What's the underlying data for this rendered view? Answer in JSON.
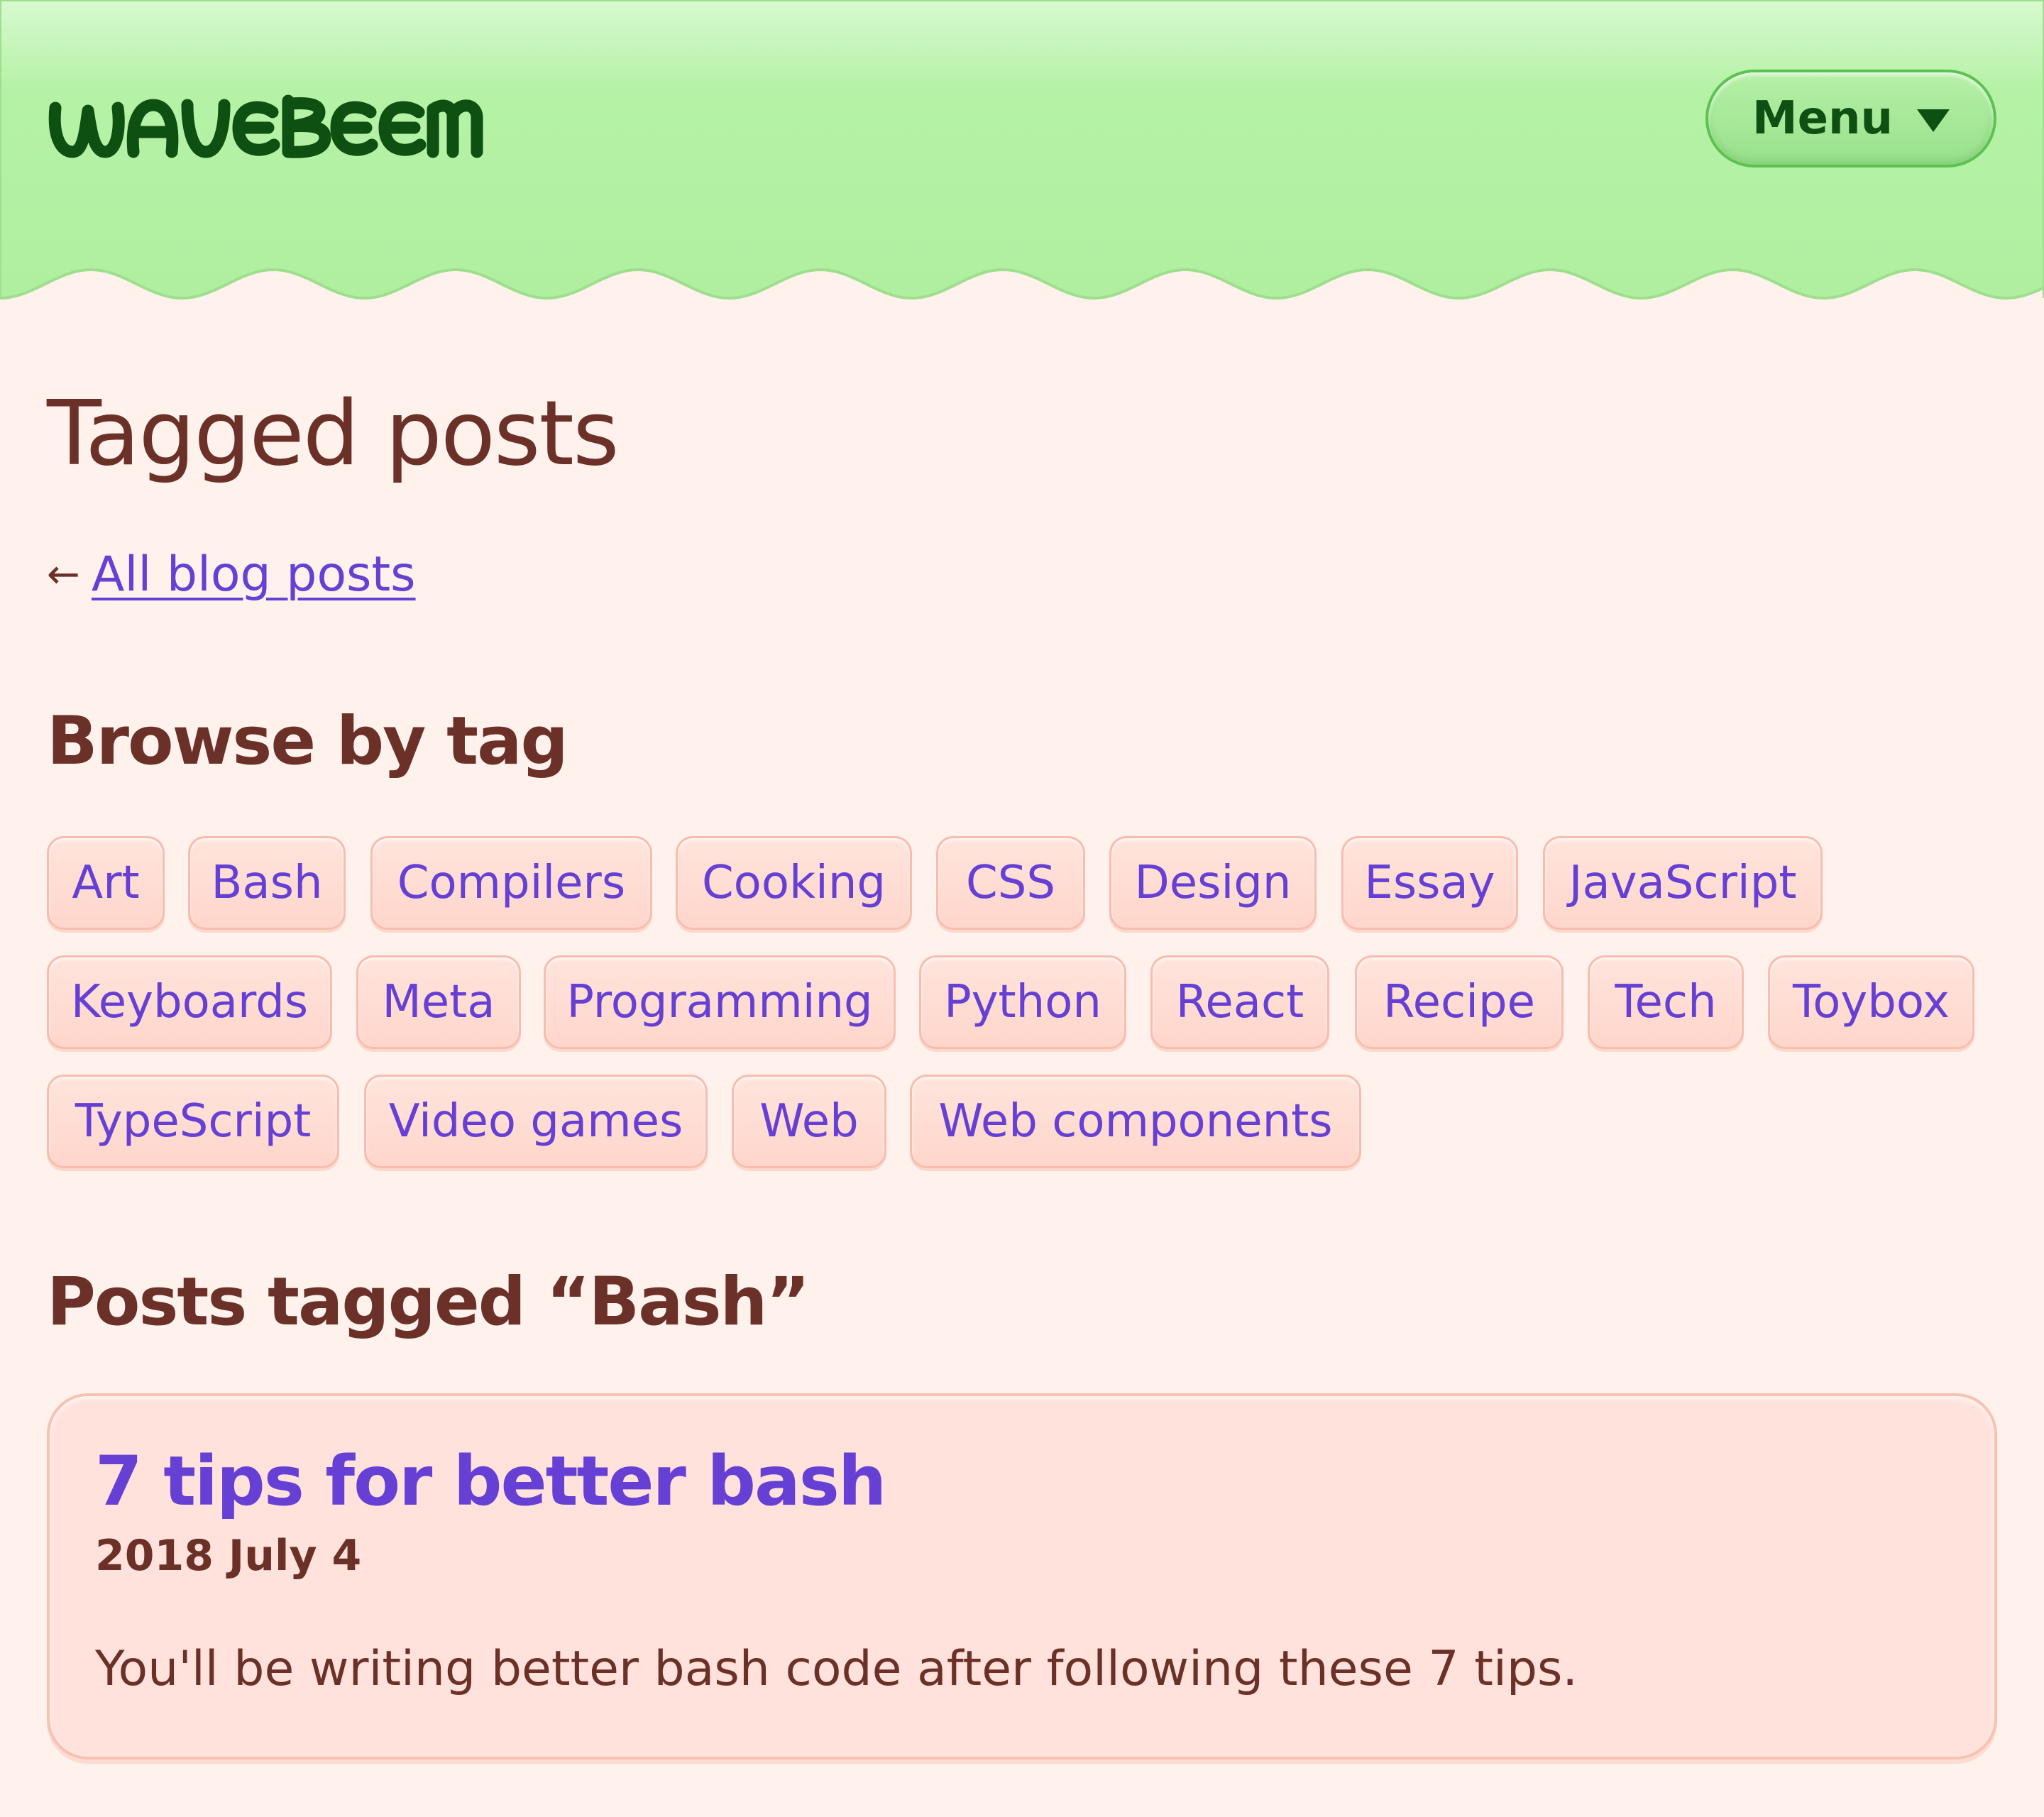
{
  "header": {
    "logo_text": "WAVEBEEM",
    "menu_label": "Menu",
    "colors": {
      "bar": "#b4f2a4",
      "accent": "#5cc252",
      "text": "#0e4f12"
    }
  },
  "page": {
    "title": "Tagged posts",
    "back_arrow": "←",
    "back_link": "All blog posts"
  },
  "browse": {
    "heading": "Browse by tag",
    "tags": [
      "Art",
      "Bash",
      "Compilers",
      "Cooking",
      "CSS",
      "Design",
      "Essay",
      "JavaScript",
      "Keyboards",
      "Meta",
      "Programming",
      "Python",
      "React",
      "Recipe",
      "Tech",
      "Toybox",
      "TypeScript",
      "Video games",
      "Web",
      "Web components"
    ]
  },
  "posts": {
    "heading": "Posts tagged “Bash”",
    "items": [
      {
        "title": "7 tips for better bash",
        "date": "2018 July 4",
        "excerpt": "You'll be writing better bash code after following these 7 tips."
      }
    ]
  },
  "colors": {
    "background": "#fff1ec",
    "text": "#6b3128",
    "link": "#6640d4",
    "tag_fill": "#ffdcd2",
    "tag_border": "#f9bdae"
  }
}
